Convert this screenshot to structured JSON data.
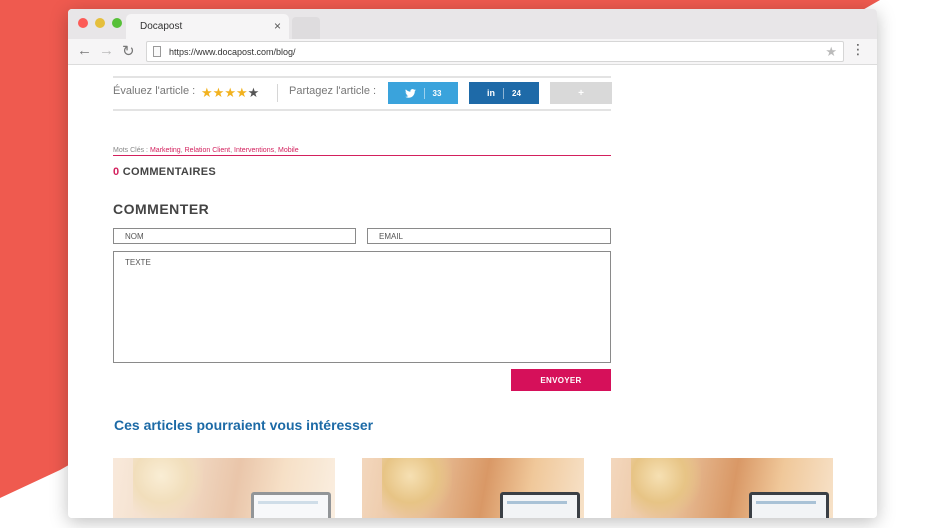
{
  "browser": {
    "tab_title": "Docapost",
    "tab_close": "×",
    "url": "https://www.docapost.com/blog/"
  },
  "rating": {
    "label": "Évaluez l'article :",
    "stars_filled": 4,
    "stars_total": 5
  },
  "share": {
    "label": "Partagez l'article :",
    "twitter_count": "33",
    "linkedin_icon": "in",
    "linkedin_count": "24",
    "more_label": "+"
  },
  "keywords": {
    "label": "Mots Clés :",
    "items": [
      "Marketing",
      "Relation Client",
      "Interventions",
      "Mobile"
    ]
  },
  "comments": {
    "count": "0",
    "count_label": "COMMENTAIRES",
    "form_title": "COMMENTER",
    "name_placeholder": "NOM",
    "email_placeholder": "EMAIL",
    "text_placeholder": "TEXTE",
    "send_label": "ENVOYER"
  },
  "related": {
    "title": "Ces articles pourraient vous intéresser"
  },
  "colors": {
    "accent_pink": "#d6105a",
    "link_blue": "#1c6aa6",
    "twitter": "#3aa3dc",
    "linkedin": "#1e6aa8",
    "background_red": "#ef5a4f"
  }
}
